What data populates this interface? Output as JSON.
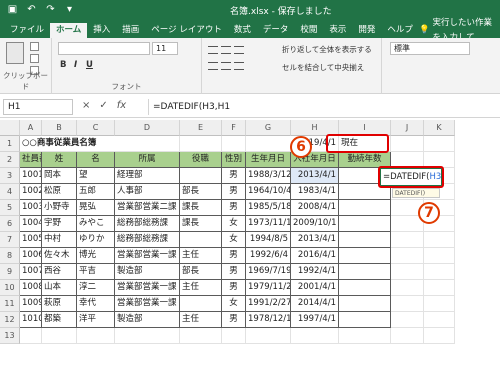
{
  "title_bar": {
    "file_title": "名簿.xlsx  -  保存しました",
    "qat_icons": [
      "save-icon",
      "undo-icon",
      "redo-icon",
      "dropdown-icon"
    ]
  },
  "ribbon_tabs": [
    {
      "label": "ファイル"
    },
    {
      "label": "ホーム"
    },
    {
      "label": "挿入"
    },
    {
      "label": "描画"
    },
    {
      "label": "ページ レイアウト"
    },
    {
      "label": "数式"
    },
    {
      "label": "データ"
    },
    {
      "label": "校閲"
    },
    {
      "label": "表示"
    },
    {
      "label": "開発"
    },
    {
      "label": "ヘルプ"
    }
  ],
  "tell_me": "実行したい作業を入力して",
  "ribbon": {
    "clipboard_label": "クリップボード",
    "font_label": "フォント",
    "font_size": "11",
    "bold": "B",
    "italic": "I",
    "underline": "U",
    "wrap_text": "折り返して全体を表示する",
    "merge_center": "セルを結合して中央揃え",
    "number_format": "標準"
  },
  "formula_bar": {
    "name_box": "H1",
    "cancel": "×",
    "enter": "✓",
    "fx": "fx",
    "formula": "=DATEDIF(H3,H1"
  },
  "columns": [
    "A",
    "B",
    "C",
    "D",
    "E",
    "F",
    "G",
    "H",
    "I",
    "J",
    "K"
  ],
  "rows": [
    "1",
    "2",
    "3",
    "4",
    "5",
    "6",
    "7",
    "8",
    "9",
    "10",
    "11",
    "12",
    "13"
  ],
  "sheet": {
    "title": "○○商事従業員名簿",
    "h1_date": "2019/4/1",
    "h1_suffix": "現在",
    "headers": [
      "社員番号",
      "姓",
      "名",
      "所属",
      "役職",
      "性別",
      "生年月日",
      "入社年月日",
      "勤続年数"
    ],
    "records": [
      [
        "1001",
        "岡本",
        "望",
        "経理部",
        "",
        "男",
        "1988/3/12",
        "2013/4/1"
      ],
      [
        "1002",
        "松原",
        "五郎",
        "人事部",
        "部長",
        "男",
        "1964/10/4",
        "1983/4/1"
      ],
      [
        "1003",
        "小野寺",
        "晃弘",
        "営業部",
        "営業二課",
        "課長",
        "男",
        "1985/5/18",
        "2008/4/1"
      ],
      [
        "1004",
        "宇野",
        "みやこ",
        "総務部",
        "総務課",
        "課長",
        "女",
        "1973/11/18",
        "2009/10/1"
      ],
      [
        "1005",
        "中村",
        "ゆりか",
        "総務部",
        "総務課",
        "",
        "女",
        "1994/8/5",
        "2013/4/1"
      ],
      [
        "1006",
        "佐々木",
        "博光",
        "営業部",
        "営業一課",
        "主任",
        "男",
        "1992/6/4",
        "2016/4/1"
      ],
      [
        "1007",
        "西谷",
        "平吉",
        "製造部",
        "",
        "部長",
        "男",
        "1969/7/19",
        "1992/4/1"
      ],
      [
        "1008",
        "山本",
        "淳二",
        "営業部",
        "営業一課",
        "主任",
        "男",
        "1979/11/2",
        "2001/4/1"
      ],
      [
        "1009",
        "萩原",
        "幸代",
        "営業部",
        "営業一課",
        "",
        "女",
        "1991/2/27",
        "2014/4/1"
      ],
      [
        "1010",
        "都築",
        "洋平",
        "製造部",
        "",
        "主任",
        "男",
        "1978/12/15",
        "1997/4/1"
      ]
    ],
    "edit_formula_main": "=DATEDIF(",
    "edit_formula_args": "H3,H1",
    "edit_tooltip": "DATEDIF()"
  },
  "callouts": {
    "step6": "6",
    "step7": "7"
  },
  "colors": {
    "excel_green": "#217346",
    "header_fill": "#a9d08e",
    "callout_red": "#e00000"
  }
}
